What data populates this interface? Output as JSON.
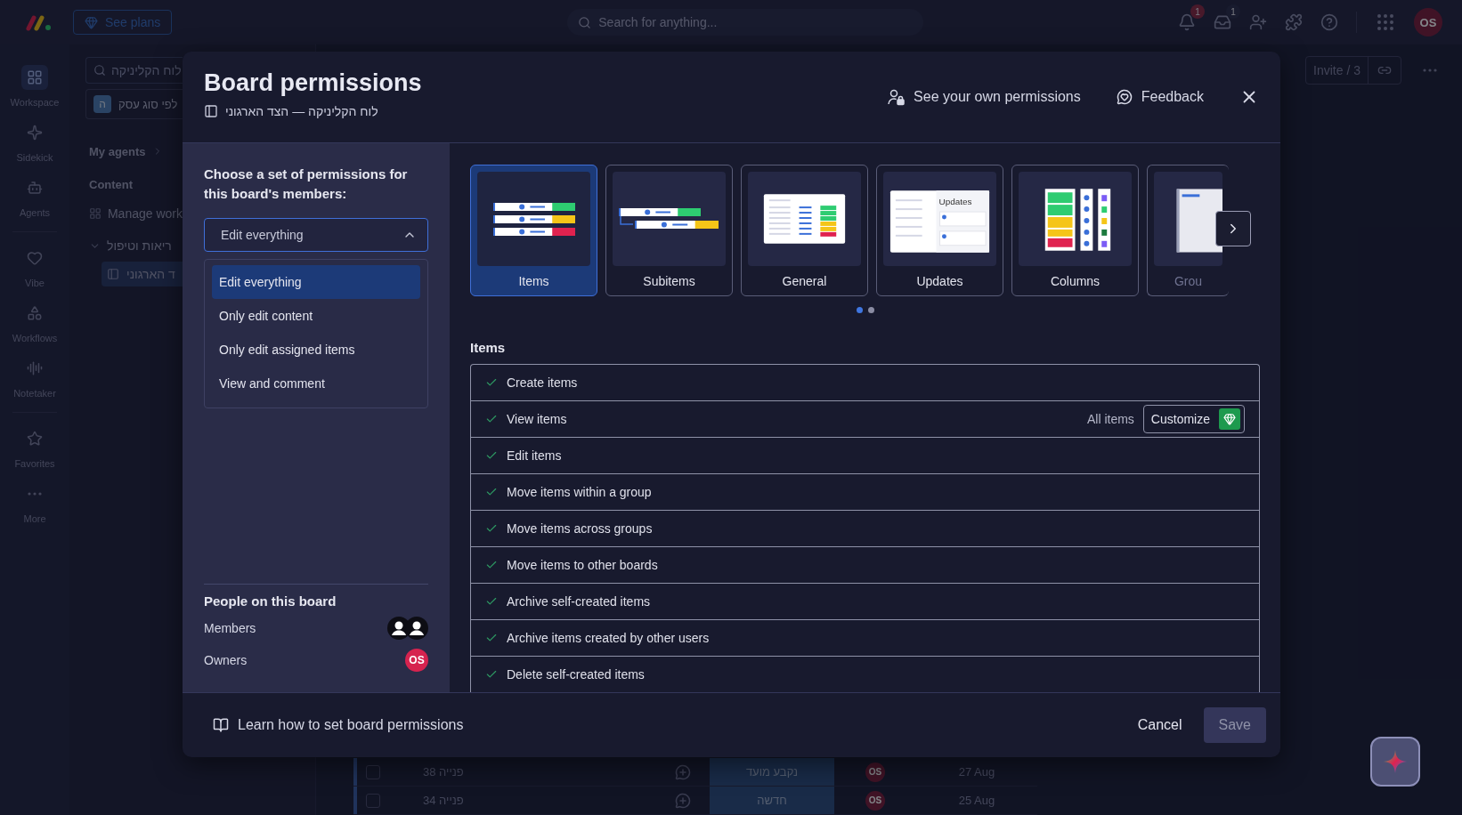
{
  "top_bar": {
    "upgrade_button": "See plans",
    "search": {
      "placeholder": "Search for anything..."
    },
    "notification_count": "1",
    "inbox_count": "1",
    "avatar": "OS"
  },
  "rail_groups": [
    [
      {
        "label": "Workspace",
        "selected": true
      },
      {
        "label": "Sidekick",
        "selected": false
      },
      {
        "label": "Agents",
        "selected": false
      }
    ],
    [
      {
        "label": "Vibe",
        "selected": false
      },
      {
        "label": "Workflows",
        "selected": false
      },
      {
        "label": "Notetaker",
        "selected": false
      }
    ],
    [
      {
        "label": "Favorites",
        "selected": false
      },
      {
        "label": "More",
        "selected": false
      }
    ]
  ],
  "side_panel": {
    "search_value": "לוח הקליניקה",
    "workspace": {
      "badge": "ה",
      "name": "לפי סוג עסק"
    },
    "my_agents": "My agents",
    "section": "Content",
    "manage": "Manage work",
    "folder": {
      "name": "ריאות וטיפול",
      "expanded": true,
      "children": [
        {
          "name": "ד הארגוני",
          "selected": true
        }
      ]
    }
  },
  "board_header": {
    "invite": "Invite / 3"
  },
  "board_rows": [
    {
      "checked": false,
      "name": "פנייה 38",
      "status": "נקבע מועד",
      "owner": "OS",
      "date": "27 Aug"
    },
    {
      "checked": false,
      "name": "פנייה 34",
      "status": "חדשה",
      "owner": "OS",
      "date": "25 Aug"
    }
  ],
  "modal": {
    "title": "Board permissions",
    "subtitle": "לוח הקליניקה — הצד הארגוני",
    "header_actions": [
      "See your own permissions",
      "Feedback"
    ],
    "prompt": "Choose a set of permissions for this board's members:",
    "preset_select": {
      "value": "Edit everything",
      "expanded": true,
      "options": [
        {
          "label": "Edit everything",
          "selected": true
        },
        {
          "label": "Only edit content",
          "selected": false
        },
        {
          "label": "Only edit assigned items",
          "selected": false
        },
        {
          "label": "View and comment",
          "selected": false
        }
      ]
    },
    "people": {
      "title": "People on this board",
      "rows": [
        {
          "label": "Members",
          "kind": "members"
        },
        {
          "label": "Owners",
          "kind": "owner",
          "initials": "OS"
        }
      ]
    },
    "categories": [
      {
        "label": "Items",
        "kind": "items",
        "selected": true
      },
      {
        "label": "Subitems",
        "kind": "subitems",
        "selected": false
      },
      {
        "label": "General",
        "kind": "general",
        "selected": false
      },
      {
        "label": "Updates",
        "kind": "updates",
        "selected": false,
        "thumb_title": "Updates"
      },
      {
        "label": "Columns",
        "kind": "columns",
        "selected": false
      },
      {
        "label": "Grou",
        "kind": "groups",
        "selected": false
      }
    ],
    "pages": [
      {
        "selected": true
      },
      {
        "selected": false
      }
    ],
    "section_title": "Items",
    "permissions": [
      {
        "label": "Create items",
        "checked": true
      },
      {
        "label": "View items",
        "checked": true,
        "scope": "All items",
        "action": "Customize"
      },
      {
        "label": "Edit items",
        "checked": true
      },
      {
        "label": "Move items within a group",
        "checked": true
      },
      {
        "label": "Move items across groups",
        "checked": true
      },
      {
        "label": "Move items to other boards",
        "checked": true
      },
      {
        "label": "Archive self-created items",
        "checked": true
      },
      {
        "label": "Archive items created by other users",
        "checked": true
      },
      {
        "label": "Delete self-created items",
        "checked": true
      }
    ],
    "footer": {
      "help_link": "Learn how to set board permissions",
      "cancel": "Cancel",
      "save": "Save",
      "save_disabled": true
    }
  }
}
